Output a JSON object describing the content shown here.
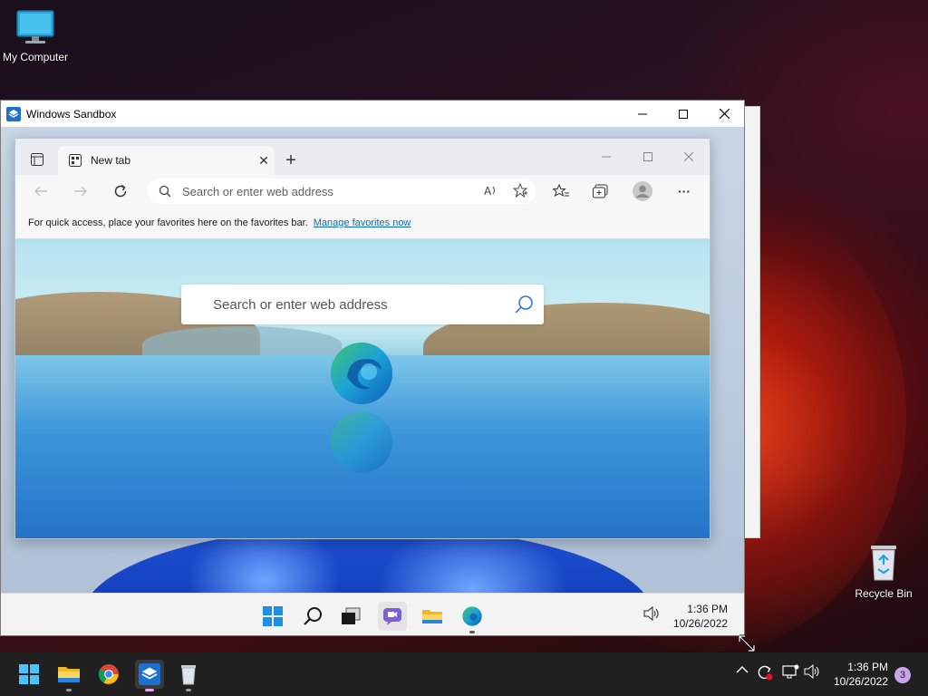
{
  "desktop": {
    "icons": [
      {
        "label": "My Computer",
        "icon": "monitor-icon"
      },
      {
        "label": "Recycle Bin",
        "icon": "recycle-bin-icon"
      }
    ]
  },
  "sandbox": {
    "title": "Windows Sandbox",
    "controls": {
      "minimize": "—",
      "maximize": "☐",
      "close": "✕"
    }
  },
  "edge": {
    "tab": {
      "label": "New tab",
      "close": "✕"
    },
    "new_tab_symbol": "+",
    "address_placeholder": "Search or enter web address",
    "favorites_bar": {
      "message": "For quick access, place your favorites here on the favorites bar.",
      "link": "Manage favorites now"
    },
    "ntp_search_placeholder": "Search or enter web address",
    "more_symbol": "···"
  },
  "sandbox_taskbar": {
    "items": [
      "start-icon",
      "search-icon",
      "task-view-icon",
      "chat-icon",
      "file-explorer-icon",
      "edge-icon"
    ],
    "clock": {
      "time": "1:36 PM",
      "date": "10/26/2022"
    }
  },
  "host_taskbar": {
    "items": [
      "start-icon",
      "file-explorer-icon",
      "chrome-icon",
      "windows-sandbox-icon",
      "recycle-bin-icon"
    ],
    "clock": {
      "time": "1:36 PM",
      "date": "10/26/2022"
    },
    "notification_count": "3"
  },
  "colors": {
    "accent": "#0f6cbd",
    "host_taskbar": "#202020",
    "sandbox_taskbar": "#f3f3f3"
  }
}
